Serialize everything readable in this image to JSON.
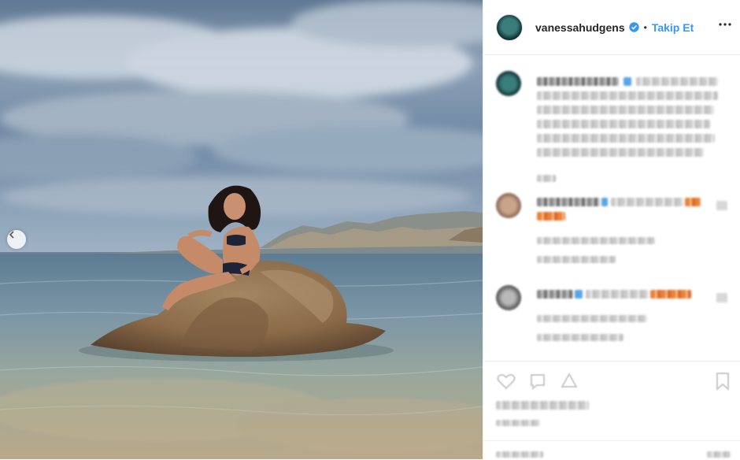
{
  "post": {
    "account": {
      "username": "vanessahudgens",
      "verified": true,
      "separator": "•",
      "follow_label": "Takip Et"
    },
    "icons": {
      "more": "more-options-icon",
      "prev": "chevron-left-icon",
      "like": "heart-icon",
      "comment": "comment-icon",
      "share": "share-icon",
      "save": "bookmark-icon",
      "verified": "verified-badge-icon"
    },
    "colors": {
      "follow": "#3897f0",
      "verified": "#3897f0",
      "text": "#262626",
      "border": "#efefef"
    }
  }
}
